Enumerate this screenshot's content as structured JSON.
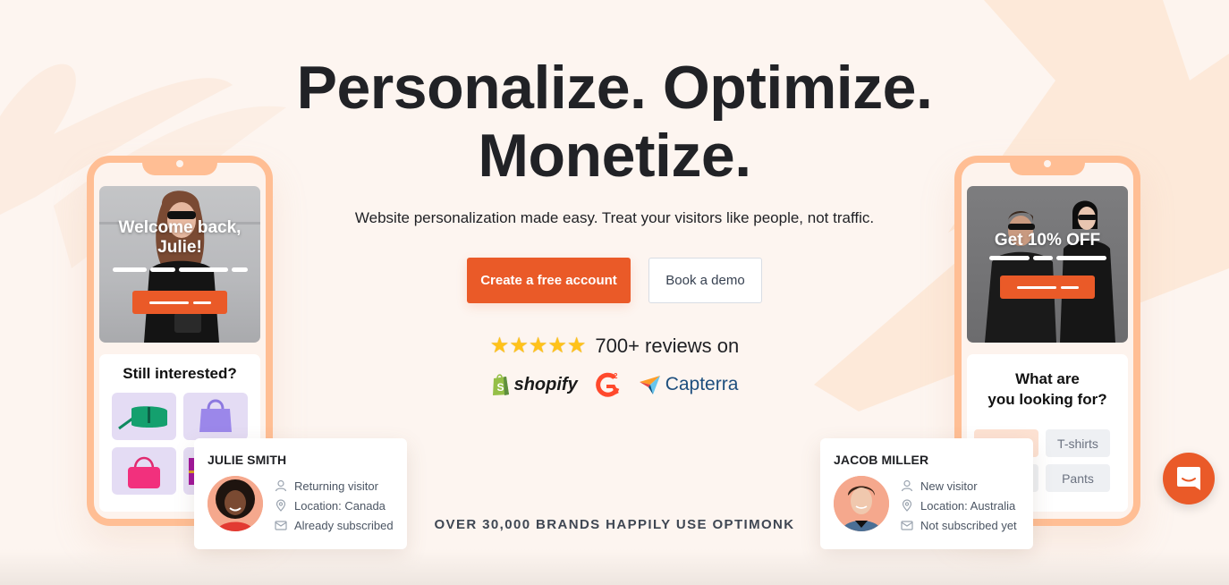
{
  "hero": {
    "headline_line1": "Personalize. Optimize.",
    "headline_line2": "Monetize.",
    "subtitle": "Website personalization made easy. Treat your visitors like people, not traffic.",
    "primary_cta": "Create a free account",
    "secondary_cta": "Book a demo"
  },
  "reviews": {
    "star_count": 5,
    "text": "700+ reviews on",
    "platforms": [
      {
        "name": "shopify",
        "label": "shopify"
      },
      {
        "name": "g2",
        "label": "G2"
      },
      {
        "name": "capterra",
        "label": "Capterra"
      }
    ]
  },
  "brands_line": "OVER 30,000 BRANDS HAPPILY USE OPTIMONK",
  "left_phone": {
    "hero_title_line1": "Welcome back,",
    "hero_title_line2": "Julie!",
    "panel_title": "Still interested?",
    "products": [
      "green-bag",
      "purple-bag",
      "pink-bag",
      "purple-wallet"
    ]
  },
  "right_phone": {
    "hero_title": "Get 10% OFF",
    "panel_title_line1": "What are",
    "panel_title_line2": "you looking for?",
    "choices": [
      "",
      "T-shirts",
      "",
      "Pants"
    ]
  },
  "visitors": [
    {
      "name": "JULIE SMITH",
      "status": "Returning visitor",
      "location": "Location: Canada",
      "subscription": "Already subscribed"
    },
    {
      "name": "JACOB MILLER",
      "status": "New visitor",
      "location": "Location: Australia",
      "subscription": "Not subscribed yet"
    }
  ],
  "colors": {
    "accent": "#ea5a28",
    "phone_frame": "#ffbe94",
    "background": "#fdf5f0",
    "headline": "#212226",
    "star": "#ffc21a",
    "shopify_green": "#95bf47",
    "g2_red": "#ff492c",
    "capterra_blue": "#1e4f7e"
  },
  "chat": {
    "icon": "chat-bubble-icon"
  }
}
